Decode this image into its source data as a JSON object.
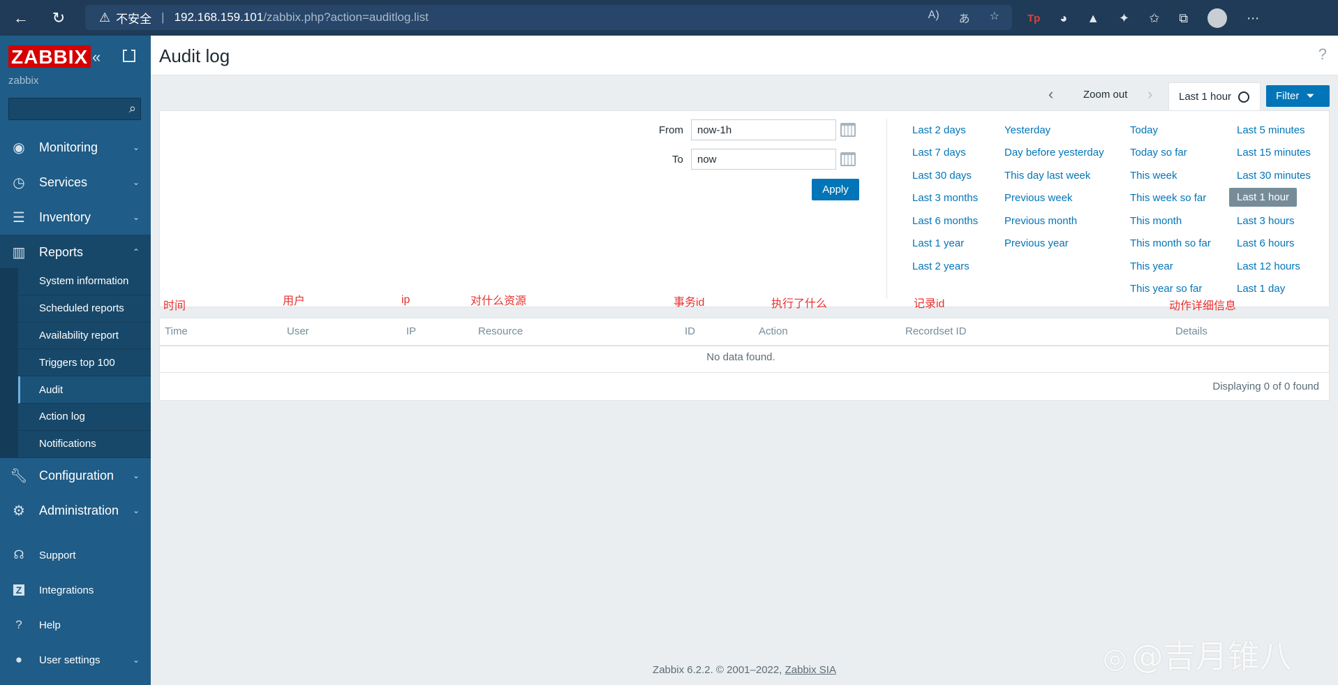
{
  "browser": {
    "security_label": "不安全",
    "url_host": "192.168.159.101",
    "url_path": "/zabbix.php?action=auditlog.list"
  },
  "sidebar": {
    "logo": "ZABBIX",
    "server_name": "zabbix",
    "search_placeholder": "",
    "menu": [
      {
        "label": "Monitoring",
        "icon": "eye-icon"
      },
      {
        "label": "Services",
        "icon": "stopwatch-icon"
      },
      {
        "label": "Inventory",
        "icon": "list-icon"
      },
      {
        "label": "Reports",
        "icon": "bar-chart-icon"
      },
      {
        "label": "Configuration",
        "icon": "wrench-icon"
      },
      {
        "label": "Administration",
        "icon": "gear-icon"
      }
    ],
    "reports_submenu": [
      "System information",
      "Scheduled reports",
      "Availability report",
      "Triggers top 100",
      "Audit",
      "Action log",
      "Notifications"
    ],
    "selected_submenu": "Audit",
    "footer": [
      {
        "label": "Support",
        "icon": "headset-icon"
      },
      {
        "label": "Integrations",
        "icon": "z-icon"
      },
      {
        "label": "Help",
        "icon": "question-icon"
      },
      {
        "label": "User settings",
        "icon": "user-icon"
      }
    ]
  },
  "header": {
    "title": "Audit log",
    "help": "?"
  },
  "time_controls": {
    "zoom_out": "Zoom out",
    "current_range": "Last 1 hour",
    "filter_label": "Filter"
  },
  "filter": {
    "from_label": "From",
    "from_value": "now-1h",
    "to_label": "To",
    "to_value": "now",
    "apply_label": "Apply",
    "quick_ranges": {
      "col1": [
        "Last 2 days",
        "Last 7 days",
        "Last 30 days",
        "Last 3 months",
        "Last 6 months",
        "Last 1 year",
        "Last 2 years"
      ],
      "col2": [
        "Yesterday",
        "Day before yesterday",
        "This day last week",
        "Previous week",
        "Previous month",
        "Previous year"
      ],
      "col3": [
        "Today",
        "Today so far",
        "This week",
        "This week so far",
        "This month",
        "This month so far",
        "This year",
        "This year so far"
      ],
      "col4": [
        "Last 5 minutes",
        "Last 15 minutes",
        "Last 30 minutes",
        "Last 1 hour",
        "Last 3 hours",
        "Last 6 hours",
        "Last 12 hours",
        "Last 1 day"
      ]
    }
  },
  "annotations": [
    "时间",
    "用户",
    "ip",
    "对什么资源",
    "事务id",
    "执行了什么",
    "记录id",
    "动作详细信息"
  ],
  "table": {
    "columns": [
      "Time",
      "User",
      "IP",
      "Resource",
      "ID",
      "Action",
      "Recordset ID",
      "Details"
    ],
    "empty_message": "No data found.",
    "paging": "Displaying 0 of 0 found"
  },
  "footer": {
    "text": "Zabbix 6.2.2. © 2001–2022,",
    "link": "Zabbix SIA"
  },
  "watermark": "@吉月锥八"
}
